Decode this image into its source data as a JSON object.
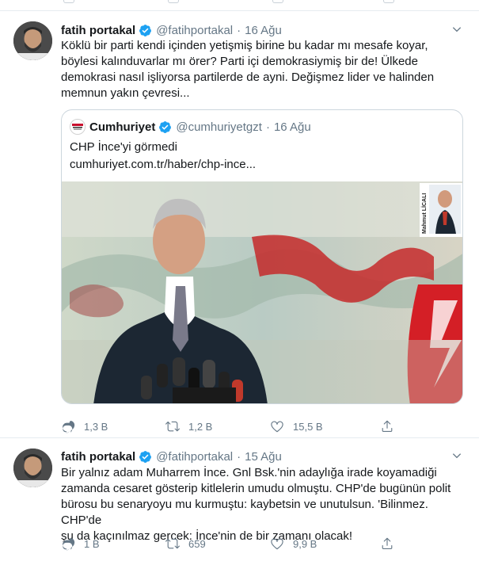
{
  "tweets": [
    {
      "author": {
        "name": "fatih portakal",
        "handle": "@fatihportakal",
        "verified": true
      },
      "date": "16 Ağu",
      "text_lines": [
        "Köklü bir parti kendi içinden yetişmiş birine bu kadar mı mesafe koyar,",
        "böylesi kalınduvarlar mı örer? Parti içi demokrasiymiş bir de! Ülkede",
        "demokrasi nasıl işliyorsa partilerde de ayni. Değişmez lider ve halinden",
        "memnun yakın çevresi..."
      ],
      "quoted": {
        "author": {
          "name": "Cumhuriyet",
          "handle": "@cumhuriyetgzt",
          "verified": true
        },
        "date": "16 Ağu",
        "text": "CHP İnce'yi görmedi",
        "link": "cumhuriyet.com.tr/haber/chp-ince...",
        "image_overlay_caption": "Mahmut LİCALI"
      },
      "actions": {
        "replies": "1,3 B",
        "retweets": "1,2 B",
        "likes": "15,5 B"
      }
    },
    {
      "author": {
        "name": "fatih portakal",
        "handle": "@fatihportakal",
        "verified": true
      },
      "date": "15 Ağu",
      "text_lines": [
        "Bir yalnız adam Muharrem İnce. Gnl Bsk.'nin adaylığa irade koyamadiği",
        "zamanda cesaret gösterip kitlelerin umudu olmuştu. CHP'de bugünün polit",
        "bürosu bu senaryoyu mu kurmuştu: kaybetsin ve unutulsun. 'Bilinmez. CHP'de",
        "şu da kaçınılmaz gercek: İnce'nin de bir zamanı olacak!"
      ],
      "actions": {
        "replies": "1 B",
        "retweets": "659",
        "likes": "9,9 B"
      }
    }
  ],
  "colors": {
    "text": "#14171a",
    "muted": "#657786",
    "verified": "#1da1f2",
    "border": "#e6ecf0"
  },
  "icons": [
    "verified-badge-icon",
    "chevron-down-icon",
    "reply-icon",
    "retweet-icon",
    "like-icon",
    "share-icon"
  ]
}
